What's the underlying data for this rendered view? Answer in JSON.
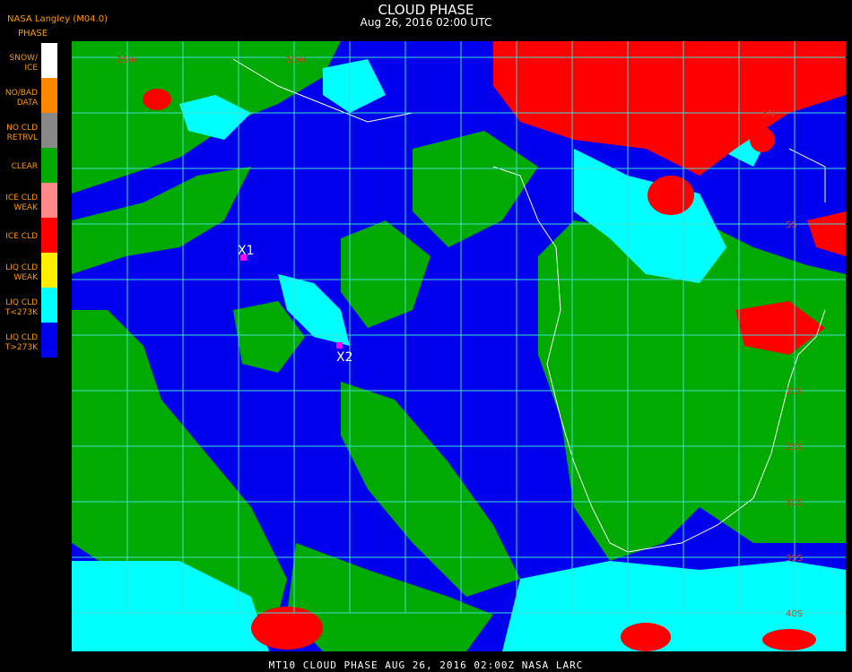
{
  "header": {
    "credit": "NASA Langley (M04.0)",
    "title": "CLOUD PHASE",
    "subtitle": "Aug 26, 2016 02:00 UTC"
  },
  "legend": {
    "title": "PHASE",
    "items": [
      {
        "label": "SNOW/\nICE",
        "color": "#ffffff"
      },
      {
        "label": "NO/BAD\nDATA",
        "color": "#ff8800"
      },
      {
        "label": "NO CLD\nRETRVL",
        "color": "#888888"
      },
      {
        "label": "CLEAR",
        "color": "#00aa00"
      },
      {
        "label": "ICE CLD\nWEAK",
        "color": "#ff8888"
      },
      {
        "label": "ICE CLD",
        "color": "#ff0000"
      },
      {
        "label": "LIQ CLD\nWEAK",
        "color": "#ffee00"
      },
      {
        "label": "LIQ CLD\nT<273K",
        "color": "#00ffff"
      },
      {
        "label": "LIQ CLD\nT>273K",
        "color": "#0000ee"
      }
    ]
  },
  "map": {
    "lon_labels": [
      "25W",
      "20W"
    ],
    "lat_labels": [
      "5N",
      "5S",
      "20S",
      "25S",
      "30S",
      "35S",
      "40S"
    ],
    "markers": [
      {
        "label": "X1",
        "color": "#ff00ff"
      },
      {
        "label": "X2",
        "color": "#ff00ff"
      }
    ],
    "grid_color": "#40e0d0",
    "coast_color": "#ffffff"
  },
  "footer": {
    "text": "MT10   CLOUD PHASE    AUG 26, 2016 02:00Z    NASA LARC"
  }
}
